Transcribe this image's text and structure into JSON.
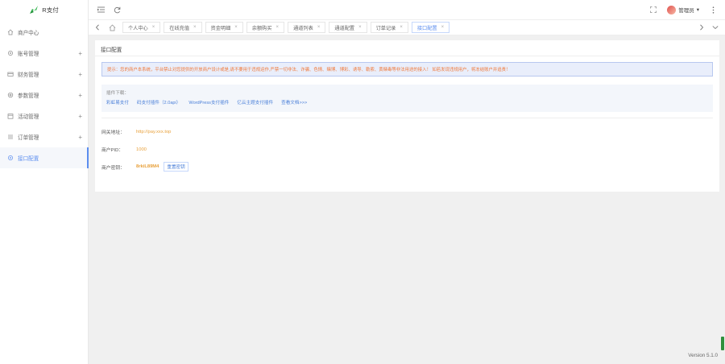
{
  "app": {
    "logo_text": "R支付",
    "accent": "#5b8def"
  },
  "sidebar": {
    "items": [
      {
        "label": "商户中心",
        "icon": "home-icon",
        "expandable": false
      },
      {
        "label": "账号管理",
        "icon": "gear-icon",
        "expandable": true,
        "plus": "+"
      },
      {
        "label": "财务管理",
        "icon": "credit-card-icon",
        "expandable": true,
        "plus": "+"
      },
      {
        "label": "参数管理",
        "icon": "gear-icon",
        "expandable": true,
        "plus": "+"
      },
      {
        "label": "活动管理",
        "icon": "calendar-icon",
        "expandable": true,
        "plus": "+"
      },
      {
        "label": "订单管理",
        "icon": "list-icon",
        "expandable": true,
        "plus": "+"
      },
      {
        "label": "接口配置",
        "icon": "settings-icon",
        "expandable": false,
        "active": true
      }
    ]
  },
  "topbar": {
    "menu_icon": "menu-fold-icon",
    "refresh_icon": "refresh-icon",
    "fullscreen_icon": "fullscreen-icon",
    "user_label": "管理员",
    "user_caret": "▾",
    "more_icon": "more-vertical-icon"
  },
  "tabs": {
    "items": [
      {
        "label": "个人中心",
        "close": "×"
      },
      {
        "label": "在线充值",
        "close": "×"
      },
      {
        "label": "资金明细",
        "close": "×"
      },
      {
        "label": "余额购买",
        "close": "×"
      },
      {
        "label": "通道列表",
        "close": "×"
      },
      {
        "label": "通道配置",
        "close": "×"
      },
      {
        "label": "订单记录",
        "close": "×"
      },
      {
        "label": "接口配置",
        "close": "×",
        "active": true
      }
    ]
  },
  "content": {
    "title": "接口配置",
    "notice": "提示：您的商户本系统，平台禁止对您提供的开放商户设计或是,请不要用于违规运作,严禁一切非法、诈骗、色情、赌博、博彩、诱导、勒索、黄赌毒等非法用途的接入！ 如若发现违规用户，将冻结账户并追责！",
    "plugins": {
      "title": "插件下载：",
      "links": [
        "彩虹易支付",
        "码支付插件（2.0api）",
        "WordPress支付插件",
        "亿云主题支付插件",
        "查看文档>>>"
      ]
    },
    "fields": {
      "api_label": "网关地址：",
      "api_value": "http://pay.xxx.top",
      "pid_label": "商户PID：",
      "pid_value": "1000",
      "key_label": "商户密钥：",
      "key_value": "8rkiL89M4",
      "reset_label": "重置密钥"
    }
  },
  "footer": {
    "version": "Version 5.1.0"
  }
}
